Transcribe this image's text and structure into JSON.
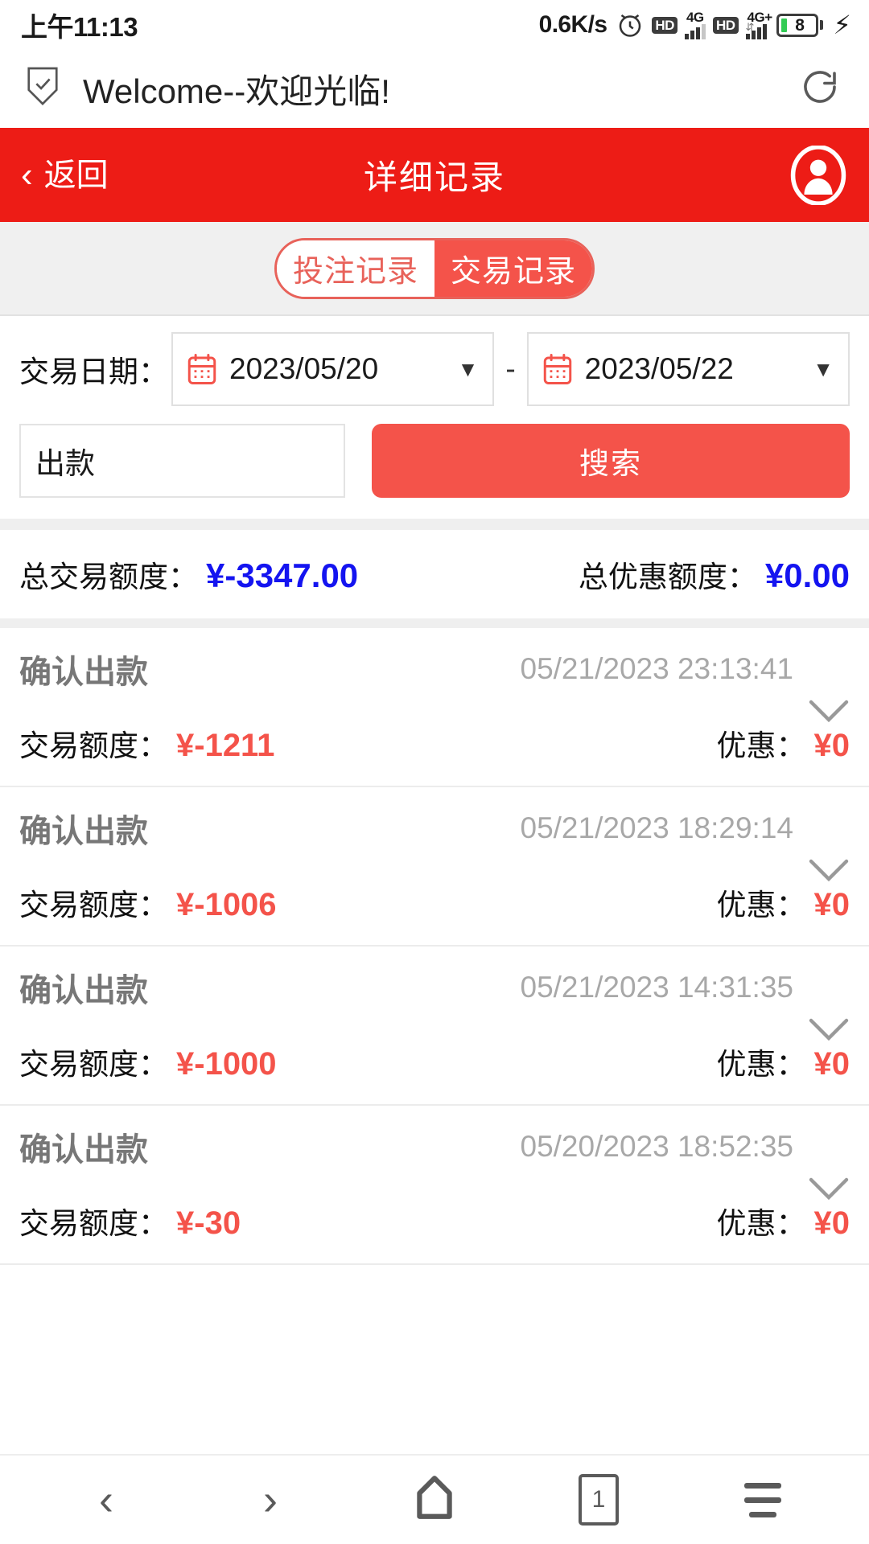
{
  "status_bar": {
    "time": "上午11:13",
    "network_speed": "0.6K/s",
    "alarm_icon": "alarm-clock-icon",
    "hd_badge_1": "HD",
    "signal_1_label": "4G",
    "hd_badge_2": "HD",
    "signal_2_label": "4G+",
    "battery_level": "8",
    "charging_icon": "charging-bolt-icon"
  },
  "browser": {
    "shield_icon": "shield-check-icon",
    "page_title": "Welcome--欢迎光临!",
    "reload_icon": "reload-icon"
  },
  "app_header": {
    "back_icon": "chevron-left-icon",
    "back_label": "返回",
    "title": "详细记录",
    "avatar_icon": "user-avatar-icon"
  },
  "tabs": [
    {
      "label": "投注记录",
      "active": false
    },
    {
      "label": "交易记录",
      "active": true
    }
  ],
  "filters": {
    "date_label": "交易日期：",
    "calendar_icon": "calendar-icon",
    "date_from": "2023/05/20",
    "date_separator": "-",
    "date_to": "2023/05/22",
    "caret_icon": "chevron-down-icon",
    "type_input_value": "出款",
    "search_button": "搜索"
  },
  "summary": {
    "total_amount_label": "总交易额度：",
    "total_amount_value": "¥-3347.00",
    "total_bonus_label": "总优惠额度：",
    "total_bonus_value": "¥0.00",
    "value_color": "#1414F0"
  },
  "transactions": [
    {
      "status": "确认出款",
      "time": "05/21/2023 23:13:41",
      "amount_label": "交易额度：",
      "amount_value": "¥-1211",
      "bonus_label": "优惠：",
      "bonus_value": "¥0",
      "expand_icon": "chevron-down-icon"
    },
    {
      "status": "确认出款",
      "time": "05/21/2023 18:29:14",
      "amount_label": "交易额度：",
      "amount_value": "¥-1006",
      "bonus_label": "优惠：",
      "bonus_value": "¥0",
      "expand_icon": "chevron-down-icon"
    },
    {
      "status": "确认出款",
      "time": "05/21/2023 14:31:35",
      "amount_label": "交易额度：",
      "amount_value": "¥-1000",
      "bonus_label": "优惠：",
      "bonus_value": "¥0",
      "expand_icon": "chevron-down-icon"
    },
    {
      "status": "确认出款",
      "time": "05/20/2023 18:52:35",
      "amount_label": "交易额度：",
      "amount_value": "¥-30",
      "bonus_label": "优惠：",
      "bonus_value": "¥0",
      "expand_icon": "chevron-down-icon"
    }
  ],
  "bottom_nav": {
    "back_icon": "chevron-left-icon",
    "forward_icon": "chevron-right-icon",
    "home_icon": "home-icon",
    "tab_count": "1",
    "menu_icon": "hamburger-menu-icon"
  },
  "theme": {
    "header_red": "#ED1C16",
    "accent_red": "#F4534A",
    "blue": "#1414F0"
  }
}
